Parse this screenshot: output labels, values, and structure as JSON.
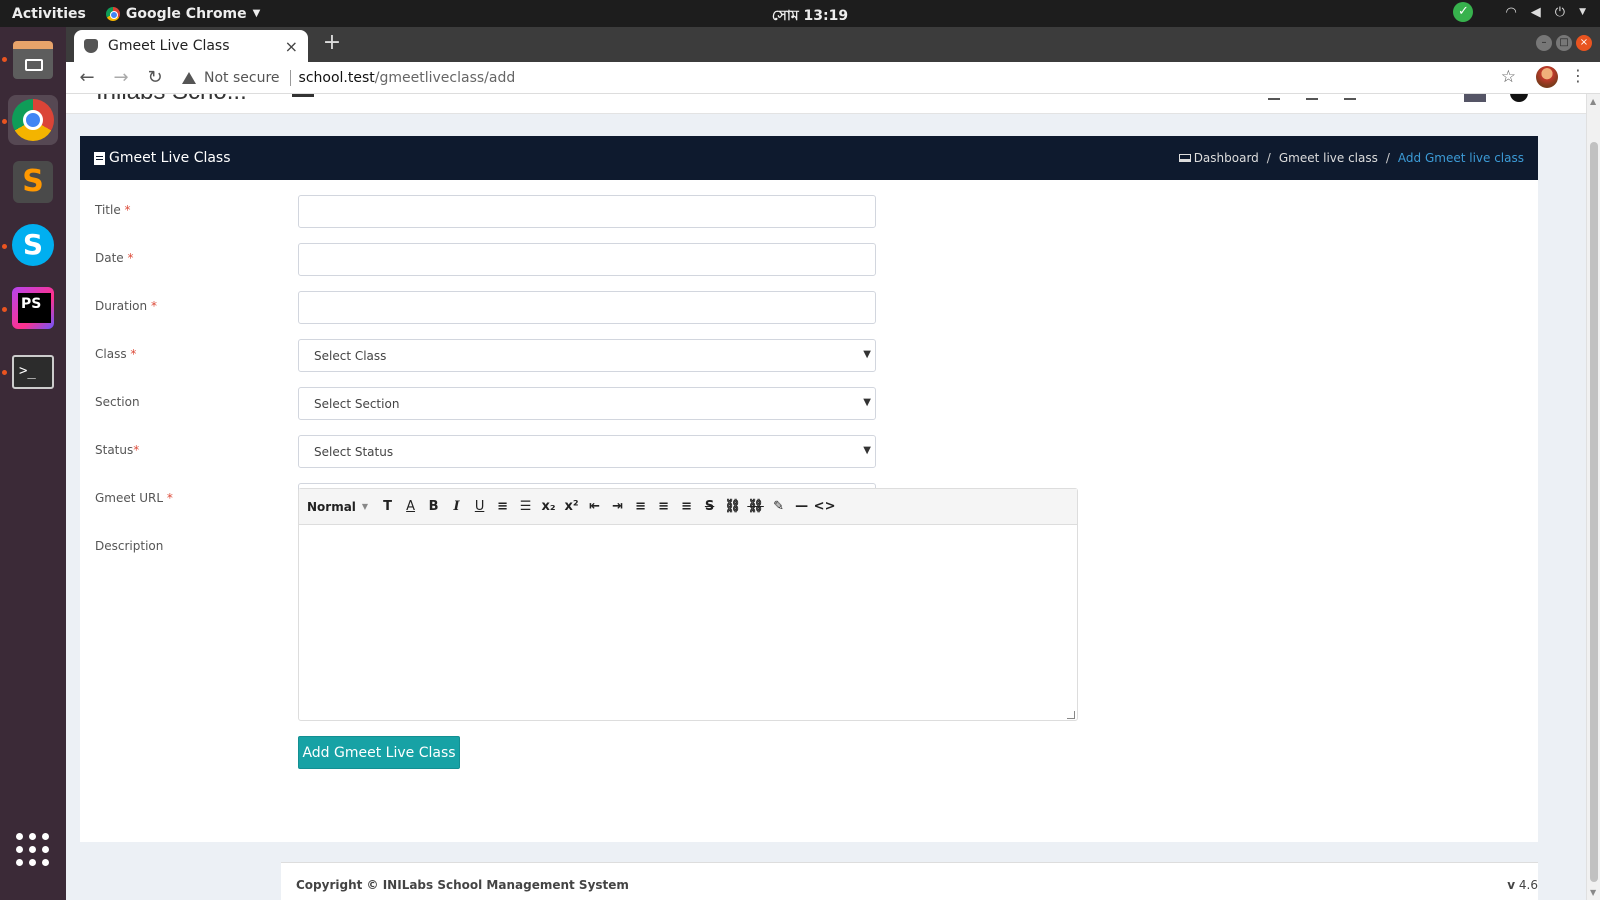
{
  "system": {
    "activities": "Activities",
    "app_name": "Google Chrome",
    "clock": "সোম 13:19"
  },
  "browser": {
    "tab_title": "Gmeet Live Class",
    "tab_close": "×",
    "new_tab": "+",
    "not_secure": "Not secure",
    "url_host": "school.test",
    "url_path": "/gmeetliveclass/add"
  },
  "app": {
    "brand": "Inilabs Scho..."
  },
  "panel": {
    "title": "Gmeet Live Class",
    "breadcrumb": [
      "Dashboard",
      "Gmeet live class",
      "Add Gmeet live class"
    ],
    "breadcrumb_sep": "/"
  },
  "form": {
    "required_mark": "*",
    "fields": [
      {
        "label": "Title",
        "required": true,
        "value": ""
      },
      {
        "label": "Date",
        "required": true,
        "value": ""
      },
      {
        "label": "Duration",
        "required": true,
        "value": ""
      },
      {
        "label": "Class",
        "required": true,
        "selected": "Select Class"
      },
      {
        "label": "Section",
        "required": false,
        "selected": "Select Section"
      },
      {
        "label": "Status",
        "required": true,
        "selected": "Select Status"
      },
      {
        "label": "Gmeet URL",
        "required": true,
        "value": ""
      },
      {
        "label": "Description",
        "required": false
      }
    ],
    "editor": {
      "style_label": "Normal",
      "buttons": [
        "T",
        "A",
        "B",
        "I",
        "U",
        "≡",
        "☰",
        "x₂",
        "x²",
        "⇤",
        "⇥",
        "≡",
        "≡",
        "≡",
        "S",
        "⛓",
        "⛓",
        "✎",
        "—",
        "<>"
      ]
    },
    "submit_label": "Add Gmeet Live Class"
  },
  "footer": {
    "copyright": "Copyright © INILabs School Management System",
    "version_prefix": "v",
    "version": "4.6"
  },
  "colors": {
    "panel_header": "#0e1a2e",
    "breadcrumb_active": "#3c9bd6",
    "required": "#dd4b39",
    "submit": "#17a2a5"
  }
}
